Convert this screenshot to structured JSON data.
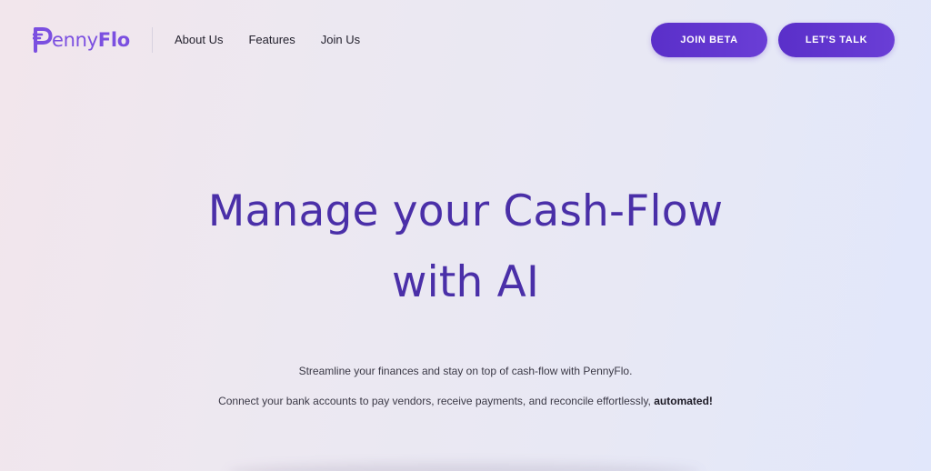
{
  "header": {
    "logo": {
      "prefix": "enny",
      "suffix": "Flo",
      "icon": "pennyflo-p-logo-icon",
      "brand_color": "#7b4fe0"
    },
    "nav": [
      {
        "label": "About Us"
      },
      {
        "label": "Features"
      },
      {
        "label": "Join Us"
      }
    ],
    "buttons": {
      "join_beta": "JOIN BETA",
      "lets_talk": "LET'S TALK"
    },
    "accent_color": "#5a2fc9"
  },
  "hero": {
    "title_line1": "Manage your Cash-Flow",
    "title_line2": "with AI",
    "title_color": "#4a2fa8",
    "subtitle_line1": "Streamline your finances and stay on top of cash-flow with PennyFlo.",
    "subtitle_line2": "Connect your bank accounts to pay vendors, receive payments, and reconcile effortlessly, ",
    "subtitle_emphasis": "automated!"
  }
}
